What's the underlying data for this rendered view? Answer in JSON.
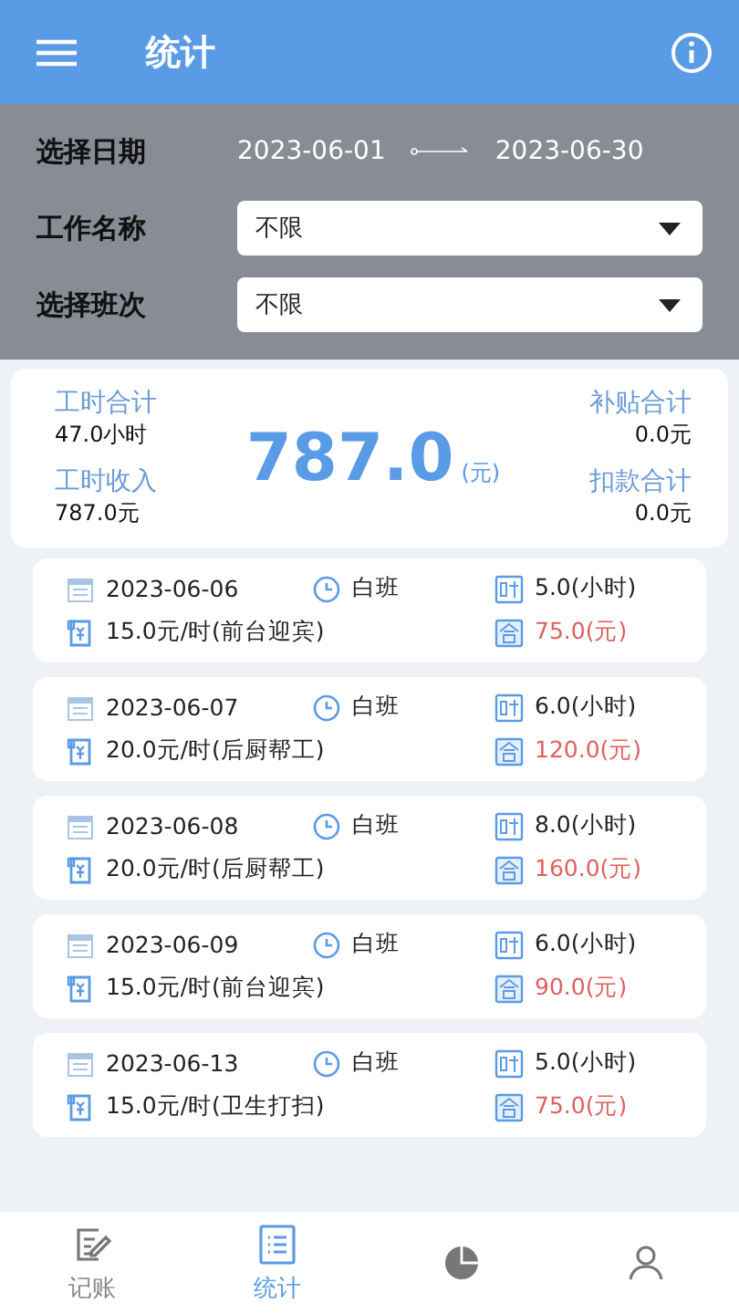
{
  "header": {
    "title": "统计"
  },
  "filters": {
    "date_label": "选择日期",
    "start_date": "2023-06-01",
    "end_date": "2023-06-30",
    "work_label": "工作名称",
    "work_value": "不限",
    "shift_label": "选择班次",
    "shift_value": "不限"
  },
  "summary": {
    "hours_label": "工时合计",
    "hours_value": "47.0小时",
    "income_label": "工时收入",
    "income_value": "787.0元",
    "total": "787.0",
    "total_unit": "(元)",
    "subsidy_label": "补贴合计",
    "subsidy_value": "0.0元",
    "deduction_label": "扣款合计",
    "deduction_value": "0.0元"
  },
  "records": [
    {
      "date": "2023-06-06",
      "shift": "白班",
      "hours": "5.0(小时)",
      "rate": "15.0元/时(前台迎宾)",
      "amount": "75.0(元)"
    },
    {
      "date": "2023-06-07",
      "shift": "白班",
      "hours": "6.0(小时)",
      "rate": "20.0元/时(后厨帮工)",
      "amount": "120.0(元)"
    },
    {
      "date": "2023-06-08",
      "shift": "白班",
      "hours": "8.0(小时)",
      "rate": "20.0元/时(后厨帮工)",
      "amount": "160.0(元)"
    },
    {
      "date": "2023-06-09",
      "shift": "白班",
      "hours": "6.0(小时)",
      "rate": "15.0元/时(前台迎宾)",
      "amount": "90.0(元)"
    },
    {
      "date": "2023-06-13",
      "shift": "白班",
      "hours": "5.0(小时)",
      "rate": "15.0元/时(卫生打扫)",
      "amount": "75.0(元)"
    }
  ],
  "tabs": [
    {
      "kind": "ledger",
      "label": "记账",
      "selected": false
    },
    {
      "kind": "stats",
      "label": "统计",
      "selected": true
    },
    {
      "kind": "chart",
      "selected": false
    },
    {
      "kind": "profile",
      "selected": false
    }
  ]
}
